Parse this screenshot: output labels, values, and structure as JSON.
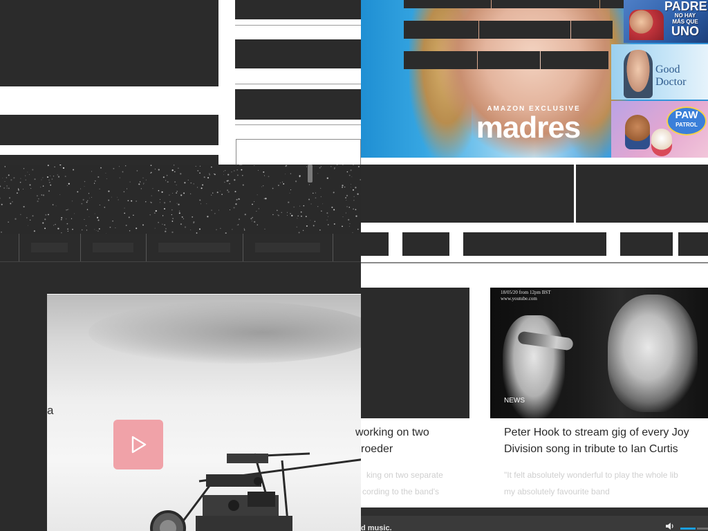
{
  "ad": {
    "exclusive_label": "AMAZON EXCLUSIVE",
    "title": "madres",
    "tiles": {
      "padre_line1": "PADRE",
      "padre_line2": "NO HAY",
      "padre_line3": "MÁS QUE",
      "padre_line4": "UNO",
      "good_doctor": "Good Doctor",
      "paw_badge": "PAW",
      "paw_badge_sub": "PATROL"
    }
  },
  "video": {
    "play_icon": "play-icon",
    "left_fragment": "a"
  },
  "cards": [
    {
      "headline_line1": "working on two",
      "headline_line2": "roeder",
      "excerpt_line1": "king on two separate",
      "excerpt_line2": "cording to the band's"
    },
    {
      "image_date_line1": "18/05/20 from 12pm BST",
      "image_date_line2": "www.youtube.com",
      "tag": "NEWS",
      "headline_line1": "Peter Hook to stream gig of every Joy",
      "headline_line2": "Division song in tribute to Ian Curtis",
      "excerpt_line1": "\"It felt absolutely wonderful to play the whole lib",
      "excerpt_line2": "my absolutely favourite band"
    }
  ],
  "audio_bar": {
    "caption": "d music.",
    "volume_icon": "volume-icon",
    "volume_level": 0.55
  },
  "colors": {
    "block": "#2b2b2b",
    "play_button": "#f0a2a8",
    "volume_fill": "#1a9fe0"
  }
}
